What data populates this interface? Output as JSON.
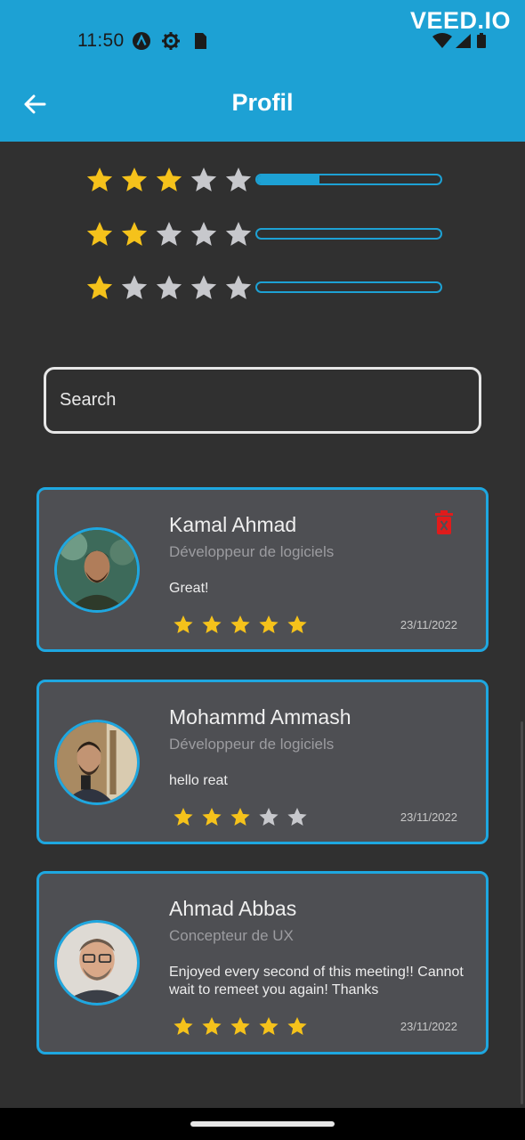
{
  "status_bar": {
    "time": "11:50",
    "watermark": "VEED.IO",
    "icons": [
      "a-icon",
      "settings-icon",
      "sim-icon",
      "wifi-icon",
      "signal-icon",
      "battery-icon"
    ]
  },
  "header": {
    "title": "Profil",
    "back_icon": "arrow-left-icon",
    "color": "#1da1d4"
  },
  "rating_summary": [
    {
      "stars": 3,
      "fill": 0.34
    },
    {
      "stars": 2,
      "fill": 0
    },
    {
      "stars": 1,
      "fill": 0
    }
  ],
  "search": {
    "placeholder": "Search",
    "value": ""
  },
  "reviews": [
    {
      "name": "Kamal Ahmad",
      "role": "Développeur de logiciels",
      "comment": "Great!",
      "rating": 5,
      "date": "23/11/2022",
      "deletable": true
    },
    {
      "name": "Mohammd Ammash",
      "role": "Développeur de logiciels",
      "comment": "hello reat",
      "rating": 3,
      "date": "23/11/2022",
      "deletable": false
    },
    {
      "name": "Ahmad Abbas",
      "role": "Concepteur de UX",
      "comment": "Enjoyed every second of this meeting!! Cannot wait to remeet you again! Thanks",
      "rating": 5,
      "date": "23/11/2022",
      "deletable": false
    }
  ],
  "colors": {
    "accent": "#1da1d4",
    "star_filled": "#f5c21b",
    "star_empty": "#c7c8cc",
    "card_bg": "#4e4f53",
    "delete": "#e01b1b"
  }
}
